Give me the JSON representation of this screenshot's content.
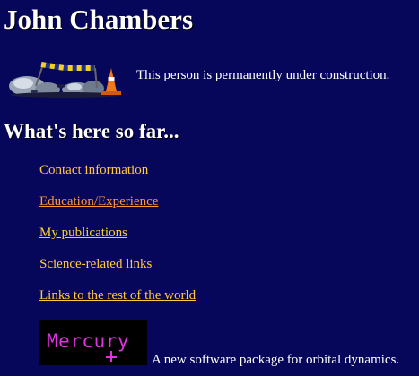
{
  "page": {
    "title": "John Chambers",
    "construction_note": "This person is permanently under construction.",
    "section_heading": "What's here so far..."
  },
  "nav": {
    "links": [
      {
        "label": "Contact information",
        "visited": false
      },
      {
        "label": "Education/Experience",
        "visited": true
      },
      {
        "label": "My publications",
        "visited": false
      },
      {
        "label": "Science-related links",
        "visited": false
      },
      {
        "label": "Links to the rest of the world",
        "visited": false
      }
    ]
  },
  "mercury": {
    "logo_text": "Mercury",
    "description": "A new software package for orbital dynamics."
  },
  "colors": {
    "background": "#06065a",
    "text": "#ffffff",
    "link": "#ffcc33",
    "link_visited": "#ff9933",
    "mercury_logo": "#e033e0"
  },
  "icons": {
    "construction": "under-construction-icon",
    "mercury": "mercury-logo-icon"
  }
}
